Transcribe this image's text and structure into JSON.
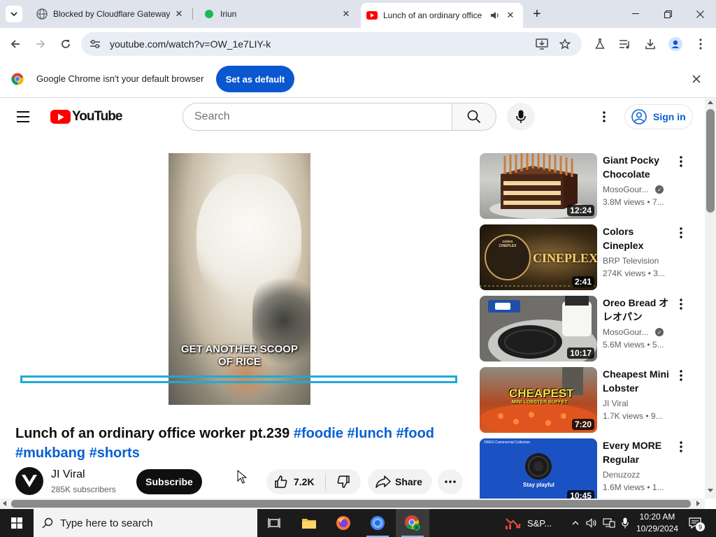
{
  "browser": {
    "tabs": [
      {
        "title": "Blocked by Cloudflare Gateway",
        "favicon": "globe-icon"
      },
      {
        "title": "Iriun",
        "favicon": "green-dot-icon"
      },
      {
        "title": "Lunch of an ordinary office",
        "favicon": "youtube-icon",
        "active": true,
        "audio": true
      }
    ],
    "url": "youtube.com/watch?v=OW_1e7LIY-k",
    "infobar": {
      "message": "Google Chrome isn't your default browser",
      "button": "Set as default"
    }
  },
  "youtube": {
    "logo_text": "YouTube",
    "search_placeholder": "Search",
    "sign_in": "Sign in",
    "video": {
      "caption_line1": "GET ANOTHER SCOOP",
      "caption_line2": "OF RICE"
    },
    "title_plain": "Lunch of an ordinary office worker pt.239 ",
    "hashtags": [
      "#foodie",
      "#lunch",
      "#food",
      "#mukbang",
      "#shorts"
    ],
    "channel": {
      "name": "JI Viral",
      "subscribers": "285K subscribers"
    },
    "subscribe_label": "Subscribe",
    "likes": "7.2K",
    "share_label": "Share",
    "recommendations": [
      {
        "title": "Giant Pocky Chocolate Cake",
        "channel": "MosoGour...",
        "verified": true,
        "meta": "3.8M views • 7...",
        "duration": "12:24"
      },
      {
        "title": "Colors Cineplex Channel Ident...",
        "channel": "BRP Television",
        "verified": false,
        "meta": "274K views • 3...",
        "duration": "2:41"
      },
      {
        "title": "Oreo Bread オレオパン",
        "channel": "MosoGour...",
        "verified": true,
        "meta": "5.6M views • 5...",
        "duration": "10:17"
      },
      {
        "title": "Cheapest Mini Lobster Buffet...",
        "channel": "JI Viral",
        "verified": false,
        "meta": "1.7K views • 9...",
        "duration": "7:20"
      },
      {
        "title": "Every MORE Regular OREO...",
        "channel": "Denuzozz",
        "verified": false,
        "meta": "1.6M views • 1...",
        "duration": "10:45"
      }
    ],
    "thumb_text": {
      "cineplex_small": "colors CINEPLEX",
      "cineplex_big": "CINEPLEX",
      "cheapest_big": "CHEAPEST",
      "cheapest_small": "MINI LOBSTER BUFFET",
      "oreo_header": "OREO Commercial Collection",
      "oreo_footer": "Stay playful"
    }
  },
  "taskbar": {
    "search_placeholder": "Type here to search",
    "news": "S&P...",
    "time": "10:20 AM",
    "date": "10/29/2024",
    "notifications": "9"
  }
}
